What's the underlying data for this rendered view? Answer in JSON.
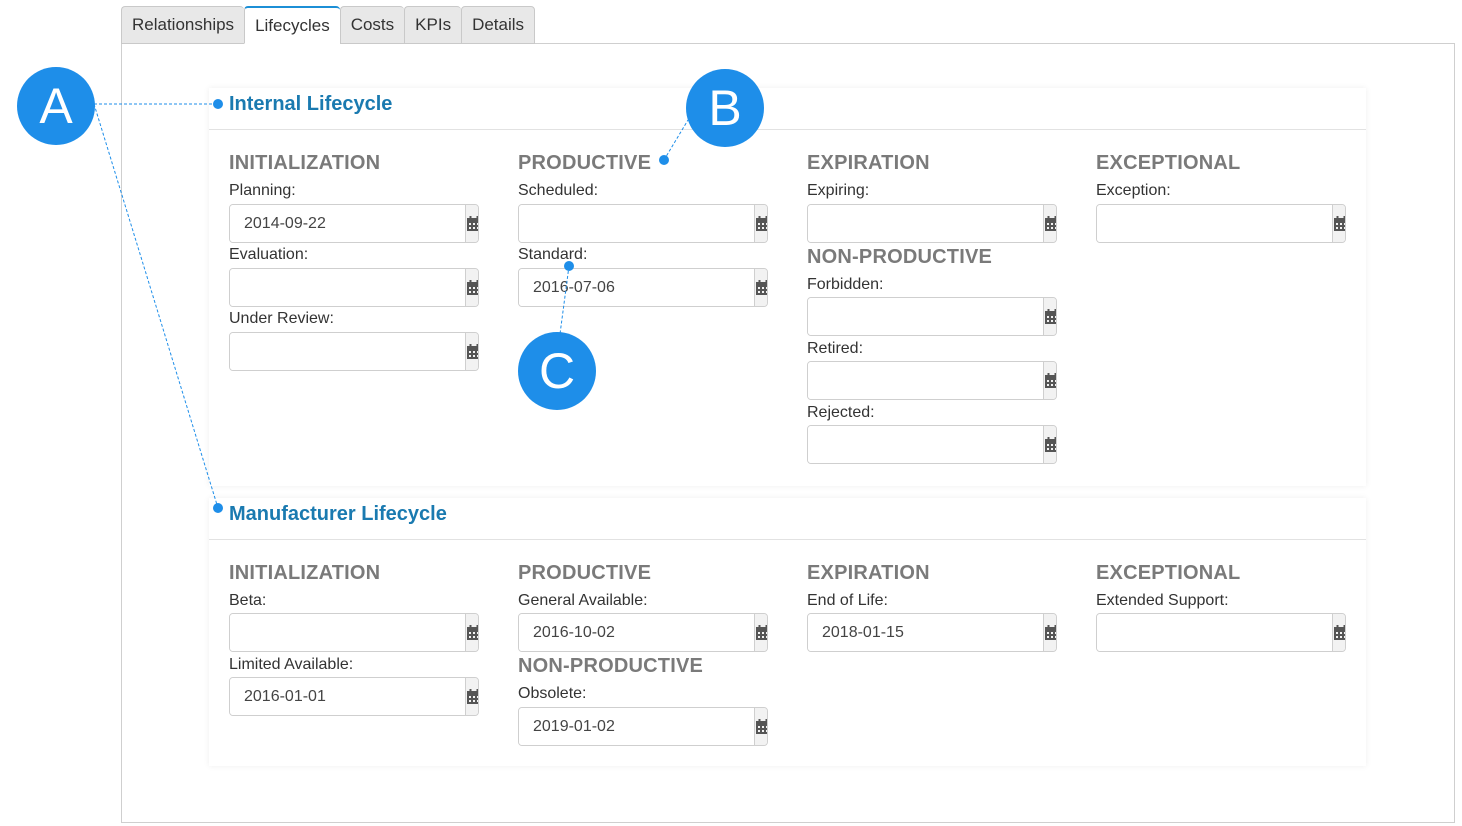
{
  "tabs": [
    "Relationships",
    "Lifecycles",
    "Costs",
    "KPIs",
    "Details"
  ],
  "active_tab": "Lifecycles",
  "callouts": [
    "A",
    "B",
    "C"
  ],
  "calendar_icon": "calendar-icon",
  "accent_color": "#1e8ee9",
  "internal": {
    "title": "Internal Lifecycle",
    "initialization": {
      "heading": "INITIALIZATION",
      "planning_label": "Planning:",
      "planning_value": "2014-09-22",
      "evaluation_label": "Evaluation:",
      "evaluation_value": "",
      "under_review_label": "Under Review:",
      "under_review_value": ""
    },
    "productive": {
      "heading": "PRODUCTIVE",
      "scheduled_label": "Scheduled:",
      "scheduled_value": "",
      "standard_label": "Standard:",
      "standard_value": "2016-07-06"
    },
    "expiration": {
      "heading": "EXPIRATION",
      "expiring_label": "Expiring:",
      "expiring_value": ""
    },
    "non_productive": {
      "heading": "NON-PRODUCTIVE",
      "forbidden_label": "Forbidden:",
      "forbidden_value": "",
      "retired_label": "Retired:",
      "retired_value": "",
      "rejected_label": "Rejected:",
      "rejected_value": ""
    },
    "exceptional": {
      "heading": "EXCEPTIONAL",
      "exception_label": "Exception:",
      "exception_value": ""
    }
  },
  "manufacturer": {
    "title": "Manufacturer Lifecycle",
    "initialization": {
      "heading": "INITIALIZATION",
      "beta_label": "Beta:",
      "beta_value": "",
      "limited_label": "Limited Available:",
      "limited_value": "2016-01-01"
    },
    "productive": {
      "heading": "PRODUCTIVE",
      "general_label": "General Available:",
      "general_value": "2016-10-02"
    },
    "non_productive": {
      "heading": "NON-PRODUCTIVE",
      "obsolete_label": "Obsolete:",
      "obsolete_value": "2019-01-02"
    },
    "expiration": {
      "heading": "EXPIRATION",
      "eol_label": "End of Life:",
      "eol_value": "2018-01-15"
    },
    "exceptional": {
      "heading": "EXCEPTIONAL",
      "extended_label": "Extended Support:",
      "extended_value": ""
    }
  }
}
